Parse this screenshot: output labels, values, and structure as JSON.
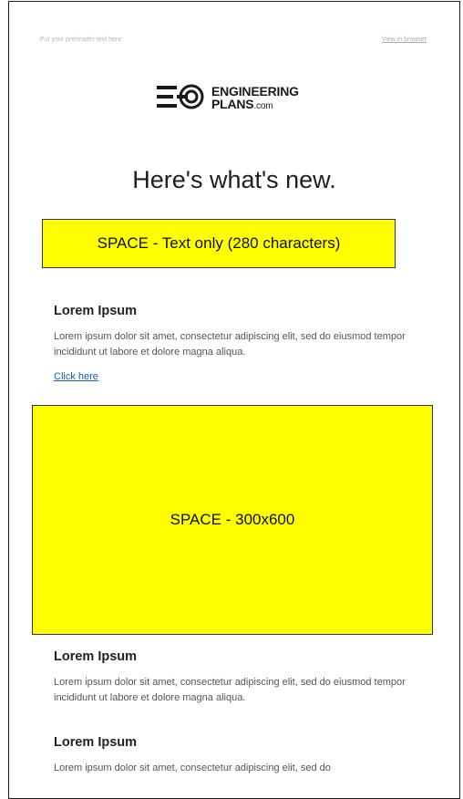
{
  "email": {
    "preheader": "Put your preheader text here",
    "view_in_browser": "View in browser",
    "logo": {
      "line1": "ENGINEERING",
      "line2": "PLANS",
      "suffix": ".com"
    },
    "headline": "Here's what's new.",
    "ad_banner": "SPACE - Text only (280 characters)",
    "articles": [
      {
        "title": "Lorem Ipsum",
        "body": "Lorem ipsum dolor sit amet, consectetur adipiscing elit, sed do eiusmod tempor incididunt ut labore et dolore magna aliqua.",
        "link": "Click here"
      },
      {
        "title": "Lorem Ipsum",
        "body": "Lorem ipsum dolor sit amet, consectetur adipiscing elit, sed do eiusmod tempor incididunt ut labore et dolore magna aliqua."
      },
      {
        "title": "Lorem Ipsum",
        "body": "Lorem ipsum dolor sit amet, consectetur adipiscing elit, sed do"
      }
    ],
    "ad_box": "SPACE - 300x600"
  },
  "colors": {
    "ad_fill": "#ffff00",
    "link": "#1a5aa6",
    "border": "#1c1c1c"
  }
}
